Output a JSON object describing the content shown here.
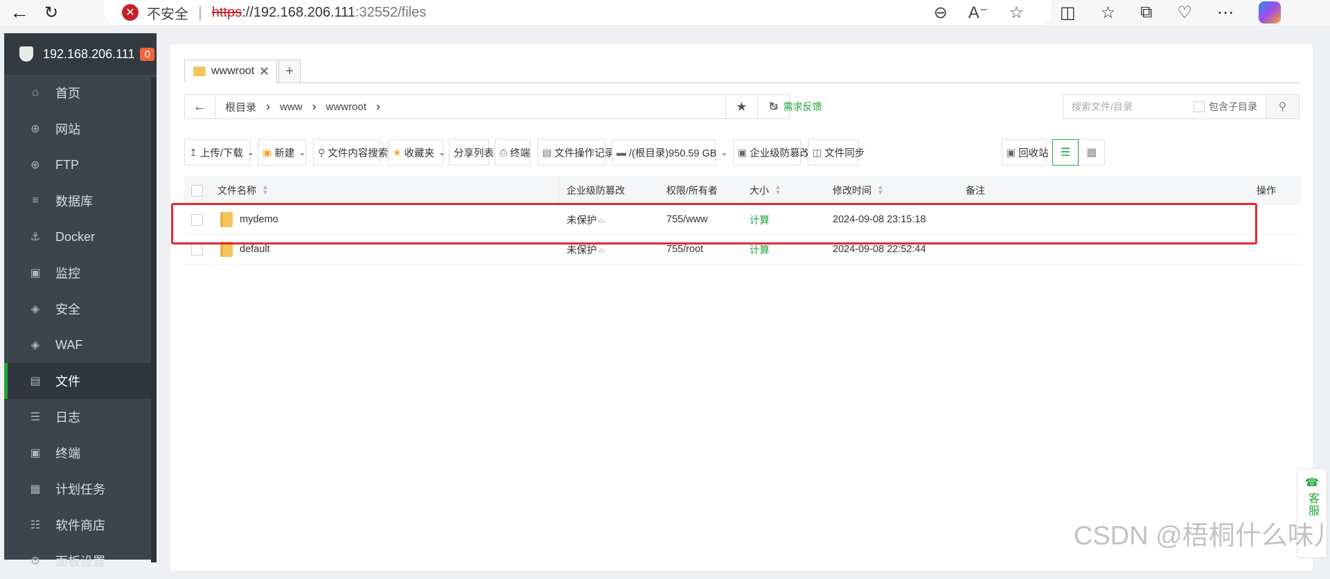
{
  "browser": {
    "security_label": "不安全",
    "url_protocol": "https",
    "url_host": "://192.168.206.111",
    "url_path": ":32552/files"
  },
  "sidebar": {
    "server_ip": "192.168.206.111",
    "alert_count": "0",
    "items": [
      {
        "label": "首页",
        "icon": "home-icon"
      },
      {
        "label": "网站",
        "icon": "globe-icon"
      },
      {
        "label": "FTP",
        "icon": "globe-icon"
      },
      {
        "label": "数据库",
        "icon": "database-icon"
      },
      {
        "label": "Docker",
        "icon": "docker-icon"
      },
      {
        "label": "监控",
        "icon": "monitor-icon"
      },
      {
        "label": "安全",
        "icon": "shield-icon"
      },
      {
        "label": "WAF",
        "icon": "shield-icon"
      },
      {
        "label": "文件",
        "icon": "folder-icon"
      },
      {
        "label": "日志",
        "icon": "log-icon"
      },
      {
        "label": "终端",
        "icon": "terminal-icon"
      },
      {
        "label": "计划任务",
        "icon": "calendar-icon"
      },
      {
        "label": "软件商店",
        "icon": "grid-icon"
      },
      {
        "label": "面板设置",
        "icon": "gear-icon"
      }
    ],
    "active_item": "文件"
  },
  "tabs": {
    "current": "wwwroot"
  },
  "path": {
    "crumbs": [
      "根目录",
      "www",
      "wwwroot"
    ],
    "feedback": "需求反馈",
    "search_placeholder": "搜索文件/目录",
    "include_sub": "包含子目录"
  },
  "toolbar": {
    "upload": "上传/下载",
    "new": "新建",
    "content_search": "文件内容搜索",
    "favorites": "收藏夹",
    "share_list": "分享列表",
    "terminal": "终端",
    "op_log": "文件操作记录",
    "disk": "/(根目录)950.59 GB",
    "tamper": "企业级防篡改",
    "sync": "文件同步",
    "recycle": "回收站"
  },
  "table": {
    "headers": {
      "name": "文件名称",
      "tamper": "企业级防篡改",
      "perm": "权限/所有者",
      "size": "大小",
      "mtime": "修改时间",
      "note": "备注",
      "ops": "操作"
    },
    "rows": [
      {
        "name": "mydemo",
        "tamper": "未保护",
        "perm": "755/www",
        "size": "计算",
        "mtime": "2024-09-08 23:15:18"
      },
      {
        "name": "default",
        "tamper": "未保护",
        "perm": "755/root",
        "size": "计算",
        "mtime": "2024-09-08 22:52:44"
      }
    ]
  },
  "service": {
    "label": "客服"
  },
  "watermark": "CSDN @梧桐什么味儿",
  "colors": {
    "accent": "#20a53a",
    "highlight": "#e8262b",
    "sidebar_bg": "#3c444d"
  }
}
